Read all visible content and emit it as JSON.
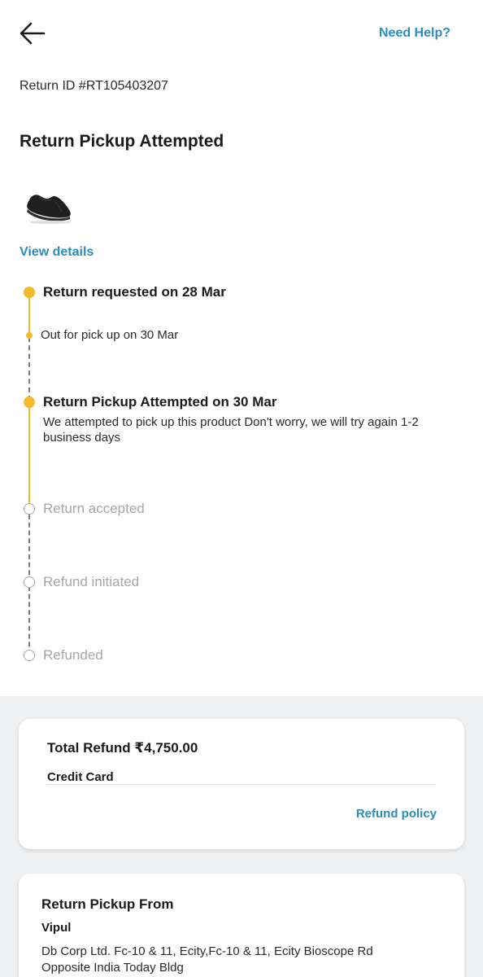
{
  "header": {
    "back_icon": "arrow-left-icon",
    "help_label": "Need Help?"
  },
  "return_id": "Return ID #RT105403207",
  "status_title": "Return Pickup Attempted",
  "product": {
    "image_icon": "shoe-icon",
    "view_details_label": "View details"
  },
  "timeline": {
    "step1": {
      "title": "Return requested on 28 Mar"
    },
    "step1_sub": {
      "text": "Out for pick up on 30 Mar"
    },
    "step2": {
      "title": "Return Pickup Attempted on 30 Mar",
      "description": "We attempted to pick up this product Don't worry, we will try again 1-2 business days"
    },
    "step3": {
      "title": "Return accepted"
    },
    "step4": {
      "title": "Refund initiated"
    },
    "step5": {
      "title": "Refunded"
    }
  },
  "refund": {
    "total": "Total Refund ₹4,750.00",
    "method": "Credit Card",
    "policy_label": "Refund policy"
  },
  "pickup": {
    "title": "Return Pickup From",
    "name": "Vipul",
    "address": "Db Corp Ltd. Fc-10 & 11, Ecity,Fc-10 & 11, Ecity Bioscope Rd Opposite India Today Bldg"
  },
  "colors": {
    "accent": "#2b8cbe",
    "progress": "#f5b92d",
    "pending_text": "#a6a6a6"
  }
}
